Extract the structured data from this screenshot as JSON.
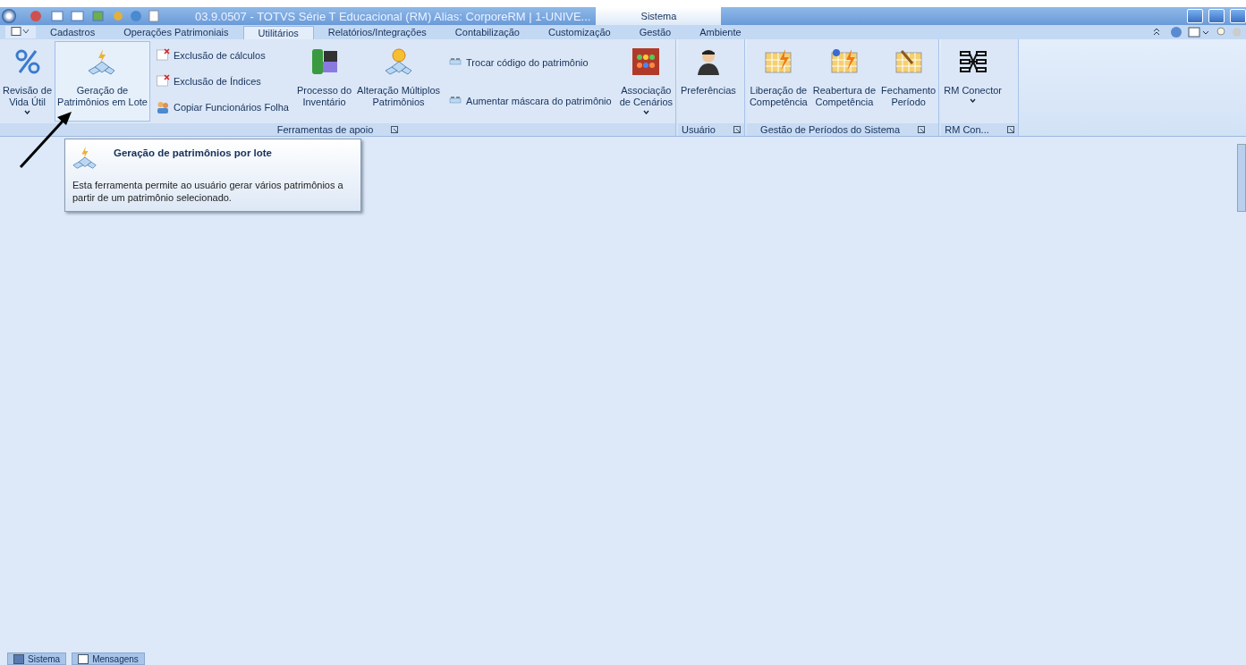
{
  "window": {
    "title": "03.9.0507 - TOTVS Série T Educacional (RM) Alias: CorporeRM | 1-UNIVE...",
    "context_tab": {
      "label": "Sistema",
      "selected": true
    }
  },
  "tabs": [
    {
      "label": "Cadastros",
      "selected": false
    },
    {
      "label": "Operações Patrimoniais",
      "selected": false
    },
    {
      "label": "Utilitários",
      "selected": true
    },
    {
      "label": "Relatórios/Integrações",
      "selected": false
    },
    {
      "label": "Contabilização",
      "selected": false
    },
    {
      "label": "Customização",
      "selected": false
    },
    {
      "label": "Gestão",
      "selected": false
    },
    {
      "label": "Ambiente",
      "selected": false
    }
  ],
  "ribbon_groups": [
    {
      "title": "Ferramentas de apoio",
      "items": [
        {
          "kind": "large",
          "lines": [
            "Revisão de",
            "Vida Útil"
          ],
          "dropdown": true,
          "selected": false
        },
        {
          "kind": "large",
          "lines": [
            "Geração de",
            "Patrimônios em Lote"
          ],
          "dropdown": false,
          "selected": true
        },
        {
          "kind": "stack",
          "entries": [
            {
              "label": "Exclusão de cálculos"
            },
            {
              "label": "Exclusão de Índices"
            },
            {
              "label": "Copiar Funcionários Folha"
            }
          ]
        },
        {
          "kind": "large",
          "lines": [
            "Processo do",
            "Inventário"
          ],
          "dropdown": false,
          "selected": false
        },
        {
          "kind": "large",
          "lines": [
            "Alteração Múltiplos",
            "Patrimônios"
          ],
          "dropdown": false,
          "selected": false
        },
        {
          "kind": "stack",
          "entries": [
            {
              "label": "Trocar código do patrimônio"
            },
            {
              "label": "Aumentar máscara do patrimônio"
            }
          ]
        },
        {
          "kind": "large",
          "lines": [
            "Associação",
            "de Cenários"
          ],
          "dropdown": true,
          "selected": false
        }
      ]
    },
    {
      "title": "Usuário",
      "items": [
        {
          "kind": "large",
          "lines": [
            "Preferências"
          ],
          "dropdown": false,
          "selected": false
        }
      ]
    },
    {
      "title": "Gestão de Períodos do Sistema",
      "items": [
        {
          "kind": "large",
          "lines": [
            "Liberação de",
            "Competência"
          ],
          "dropdown": false,
          "selected": false
        },
        {
          "kind": "large",
          "lines": [
            "Reabertura de",
            "Competência"
          ],
          "dropdown": false,
          "selected": false
        },
        {
          "kind": "large",
          "lines": [
            "Fechamento",
            "Período"
          ],
          "dropdown": false,
          "selected": false
        }
      ]
    },
    {
      "title": "RM Con...",
      "items": [
        {
          "kind": "large",
          "lines": [
            "RM Conector"
          ],
          "dropdown": true,
          "selected": false
        }
      ]
    }
  ],
  "tooltip": {
    "title": "Geração de patrimônios por lote",
    "text": "Esta ferramenta permite ao usuário gerar vários patrimônios a partir de um patrimônio selecionado."
  },
  "taskbar": [
    {
      "label": "Sistema"
    },
    {
      "label": "Mensagens"
    }
  ]
}
